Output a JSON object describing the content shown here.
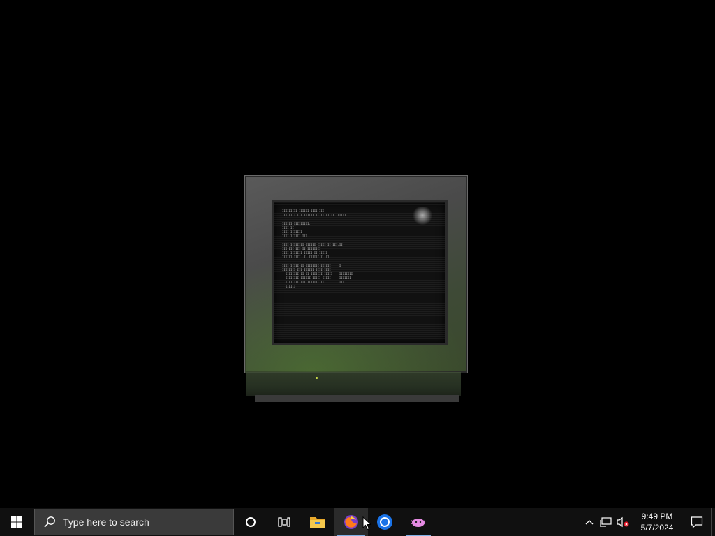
{
  "desktop": {
    "monitor": {
      "screen_lines": [
        "IIIIIIIII IIIIII IIII III.",
        "IIIIIIII III IIIIII IIIII IIIII IIIIII",
        "",
        "IIIIII IIIIIIIII.",
        "IIII II",
        "IIII IIIIIII",
        "IIII IIIIII III",
        "",
        "IIII IIIIIIII IIIIII IIIII II III.II",
        "III III III II IIIIIIII",
        "IIII IIIIIII IIIII II IIIII",
        "IIIIII IIII  I  IIIIII I  II",
        "",
        "IIII IIIII II IIIIIIII IIIIII     I",
        "IIIIIIII III IIIIII IIII IIII",
        "  IIIIIIII II II IIIIIII IIIII    IIIIIIII",
        "  IIIIIIII IIIIII IIIII IIIII     IIIIIII",
        "  IIIIIIII III IIIIIII II         III",
        "  IIIIII"
      ]
    }
  },
  "taskbar": {
    "start_icon": "windows-logo-icon",
    "search": {
      "placeholder": "Type here to search"
    },
    "apps": [
      {
        "name": "cortana",
        "icon": "circle-icon"
      },
      {
        "name": "task-view",
        "icon": "task-view-icon"
      },
      {
        "name": "file-explorer",
        "icon": "folder-icon"
      },
      {
        "name": "firefox",
        "icon": "firefox-icon",
        "active": true
      },
      {
        "name": "chrome",
        "icon": "chrome-icon"
      },
      {
        "name": "app",
        "icon": "pink-creature-icon",
        "running": true
      }
    ],
    "tray": {
      "time": "9:49 PM",
      "date": "5/7/2024"
    }
  },
  "colors": {
    "taskbar_bg": "#101010",
    "search_bg": "#3a3a3a",
    "active_underline": "#7fb0e6",
    "crt_glow": "#5a8c32"
  }
}
